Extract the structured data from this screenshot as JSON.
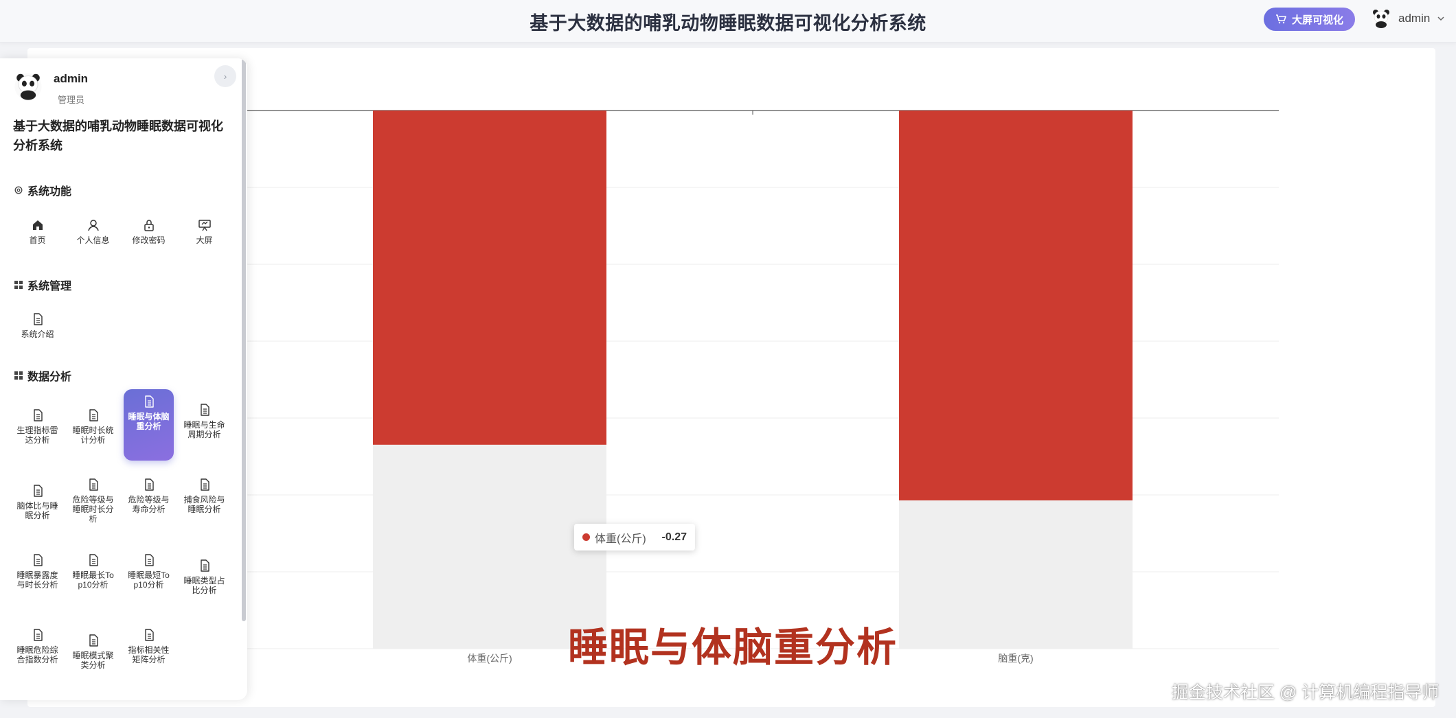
{
  "header": {
    "title": "基于大数据的哺乳动物睡眠数据可视化分析系统",
    "big_screen_button": "大屏可视化",
    "username": "admin"
  },
  "sidebar": {
    "username": "admin",
    "role": "管理员",
    "system_name": "基于大数据的哺乳动物睡眠数据可视化分析系统",
    "sections": [
      {
        "title": "系统功能",
        "items": [
          {
            "label": "首页",
            "icon": "home-icon"
          },
          {
            "label": "个人信息",
            "icon": "user-icon"
          },
          {
            "label": "修改密码",
            "icon": "lock-icon"
          },
          {
            "label": "大屏",
            "icon": "screen-icon"
          }
        ]
      },
      {
        "title": "系统管理",
        "items": [
          {
            "label": "系统介绍",
            "icon": "document-icon"
          }
        ]
      },
      {
        "title": "数据分析",
        "items": [
          {
            "label": "生理指标雷达分析",
            "icon": "document-icon"
          },
          {
            "label": "睡眠时长统计分析",
            "icon": "document-icon"
          },
          {
            "label": "睡眠与体脑重分析",
            "icon": "document-icon",
            "active": true
          },
          {
            "label": "睡眠与生命周期分析",
            "icon": "document-icon"
          },
          {
            "label": "脑体比与睡眠分析",
            "icon": "document-icon"
          },
          {
            "label": "危险等级与睡眠时长分析",
            "icon": "document-icon"
          },
          {
            "label": "危险等级与寿命分析",
            "icon": "document-icon"
          },
          {
            "label": "捕食风险与睡眠分析",
            "icon": "document-icon"
          },
          {
            "label": "睡眠暴露度与时长分析",
            "icon": "document-icon"
          },
          {
            "label": "睡眠最长Top10分析",
            "icon": "document-icon"
          },
          {
            "label": "睡眠最短Top10分析",
            "icon": "document-icon"
          },
          {
            "label": "睡眠类型占比分析",
            "icon": "document-icon"
          },
          {
            "label": "睡眠危险综合指数分析",
            "icon": "document-icon"
          },
          {
            "label": "睡眠模式聚类分析",
            "icon": "document-icon"
          },
          {
            "label": "指标相关性矩阵分析",
            "icon": "document-icon"
          }
        ]
      }
    ]
  },
  "chart_data": {
    "type": "bar",
    "categories": [
      "体重(公斤)",
      "脑重(克)"
    ],
    "series": [
      {
        "name": "体重(公斤)",
        "values": [
          -0.27,
          null
        ]
      }
    ],
    "tooltip": {
      "series": "体重(公斤)",
      "value": "-0.27"
    },
    "colors": {
      "bar": "#cc3b30",
      "shadow": "#efefef"
    },
    "grid": true
  },
  "overlay_title": "睡眠与体脑重分析",
  "watermark": "掘金技术社区 @ 计算机编程指导师"
}
